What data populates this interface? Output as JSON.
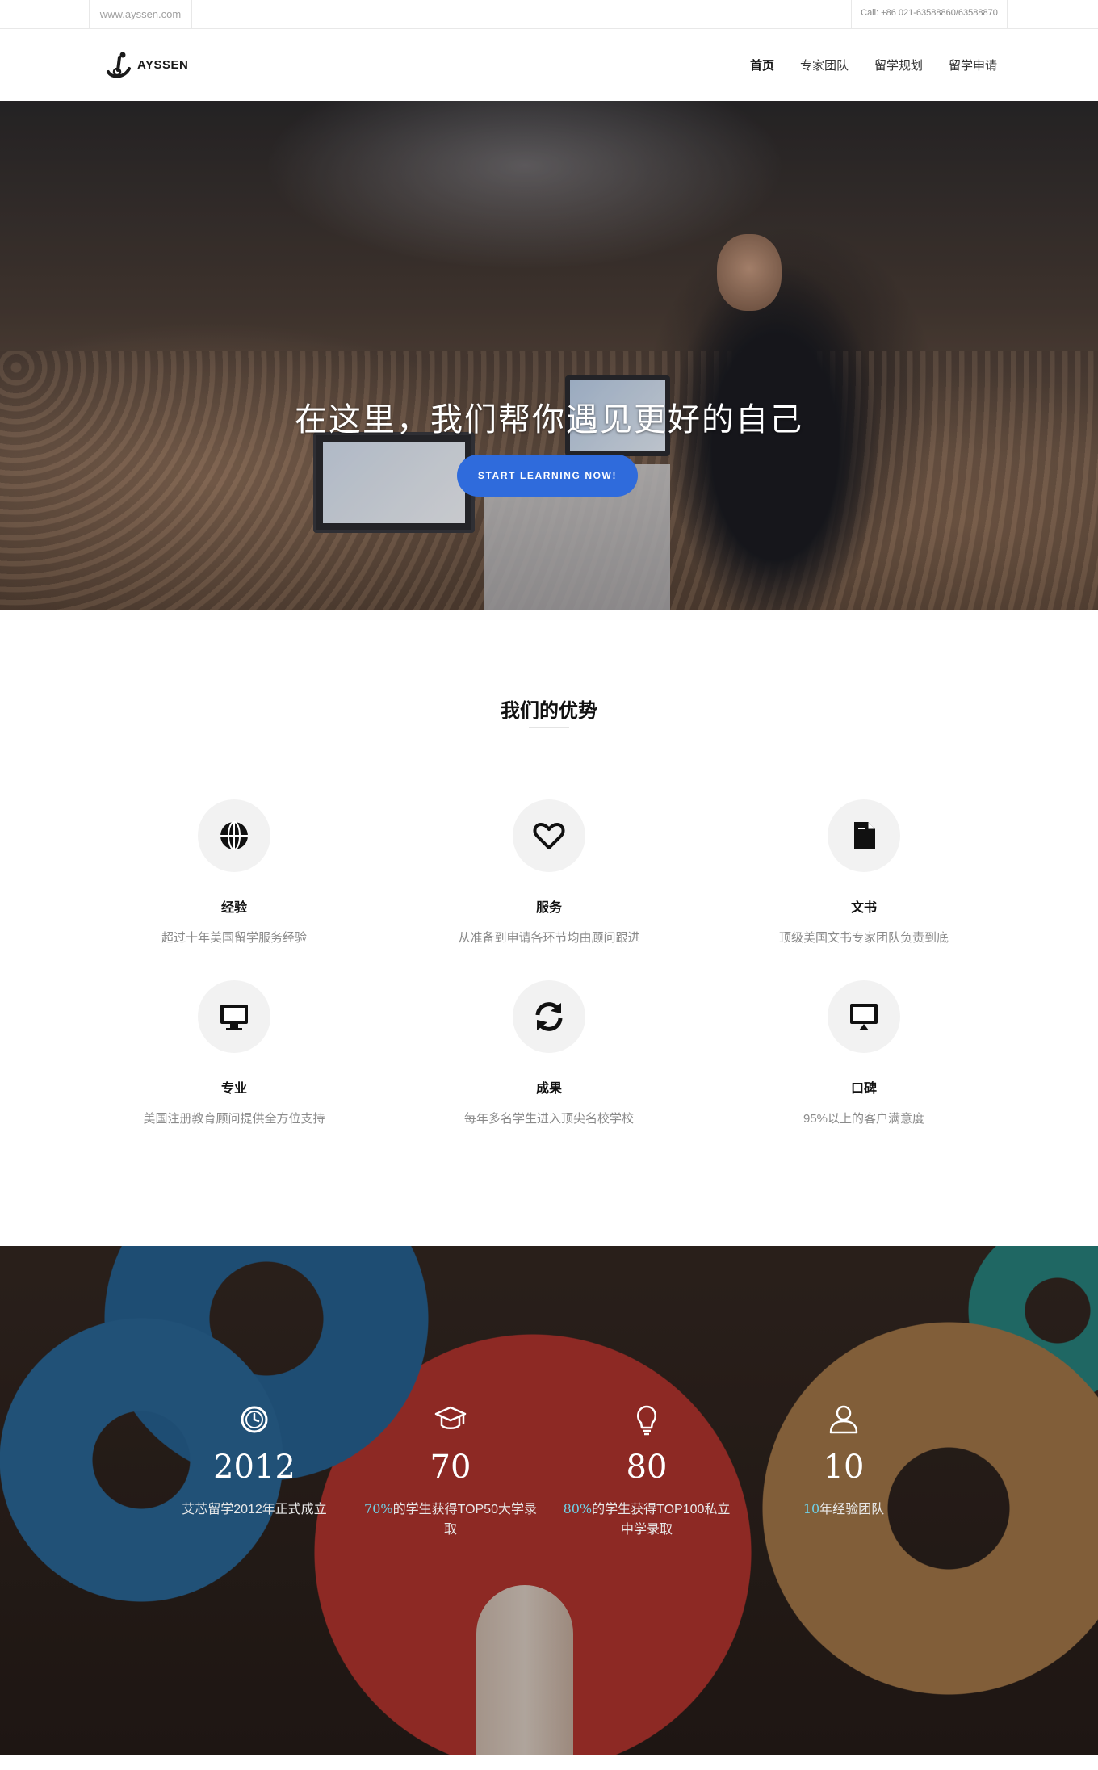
{
  "topbar": {
    "site_url": "www.ayssen.com",
    "contact": "Call: +86 021-63588860/63588870"
  },
  "header": {
    "logo_text": "AYSSEN",
    "nav": [
      {
        "label": "首页",
        "active": true
      },
      {
        "label": "专家团队",
        "active": false
      },
      {
        "label": "留学规划",
        "active": false
      },
      {
        "label": "留学申请",
        "active": false
      }
    ]
  },
  "hero": {
    "title": "在这里，我们帮你遇见更好的自己",
    "button_label": "START LEARNING NOW!",
    "slide_count": 3,
    "active_slide": 2
  },
  "advantages": {
    "title": "我们的优势",
    "items": [
      {
        "icon": "globe-icon",
        "title": "经验",
        "desc": "超过十年美国留学服务经验"
      },
      {
        "icon": "heart-icon",
        "title": "服务",
        "desc": "从准备到申请各环节均由顾问跟进"
      },
      {
        "icon": "document-icon",
        "title": "文书",
        "desc": "顶级美国文书专家团队负责到底"
      },
      {
        "icon": "monitor-icon",
        "title": "专业",
        "desc": "美国注册教育顾问提供全方位支持"
      },
      {
        "icon": "refresh-icon",
        "title": "成果",
        "desc": "每年多名学生进入顶尖名校学校"
      },
      {
        "icon": "desktop-icon",
        "title": "口碑",
        "desc": "95%以上的客户满意度"
      }
    ]
  },
  "stats": [
    {
      "icon": "clock-icon",
      "number": "2012",
      "desc_hl": "",
      "desc": "艾芯留学2012年正式成立"
    },
    {
      "icon": "graduation-cap-icon",
      "number": "70",
      "desc_hl": "70%",
      "desc": "的学生获得TOP50大学录取"
    },
    {
      "icon": "lightbulb-icon",
      "number": "80",
      "desc_hl": "80%",
      "desc": "的学生获得TOP100私立中学录取"
    },
    {
      "icon": "user-icon",
      "number": "10",
      "desc_hl": "10",
      "desc": "年经验团队"
    }
  ],
  "colors": {
    "accent_button": "#2f6bdc",
    "stat_highlight": "#6fd0e6"
  }
}
